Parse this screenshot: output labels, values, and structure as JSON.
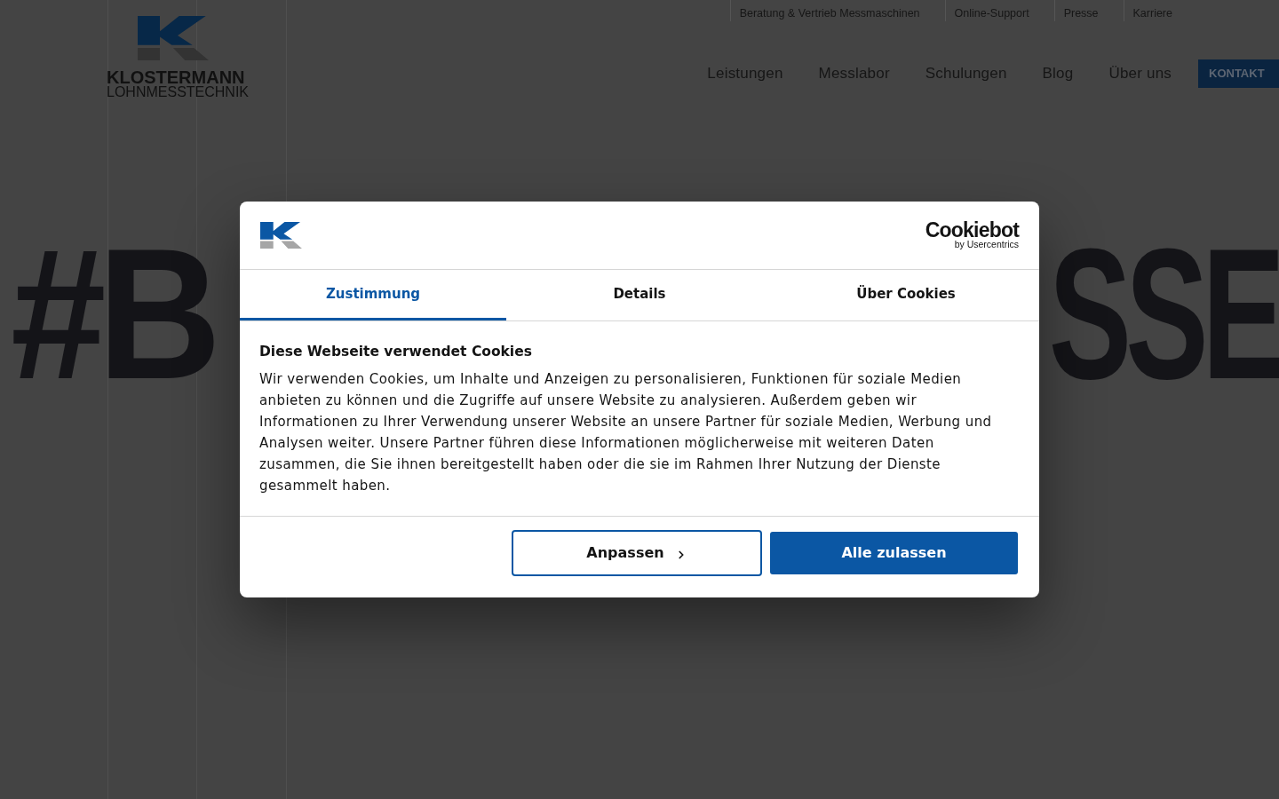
{
  "header": {
    "logo": {
      "name": "KLOSTERMANN",
      "tagline": "LOHNMESSTECHNIK"
    },
    "top_links": [
      "Beratung & Vertrieb Messmaschinen",
      "Online-Support",
      "Presse",
      "Karriere"
    ],
    "nav": [
      "Leistungen",
      "Messlabor",
      "Schulungen",
      "Blog",
      "Über uns"
    ],
    "contact_button": "KONTAKT"
  },
  "hero": {
    "headline_parts": [
      "#B",
      "SSE"
    ]
  },
  "cookie_dialog": {
    "provider": {
      "name": "Cookiebot",
      "byline": "by Usercentrics"
    },
    "tabs": [
      {
        "label": "Zustimmung",
        "selected": true
      },
      {
        "label": "Details",
        "selected": false
      },
      {
        "label": "Über Cookies",
        "selected": false
      }
    ],
    "title": "Diese Webseite verwendet Cookies",
    "body": "Wir verwenden Cookies, um Inhalte und Anzeigen zu personalisieren, Funktionen für soziale Medien anbieten zu können und die Zugriffe auf unsere Website zu analysieren. Außerdem geben wir Informationen zu Ihrer Verwendung unserer Website an unsere Partner für soziale Medien, Werbung und Analysen weiter. Unsere Partner führen diese Informationen möglicherweise mit weiteren Daten zusammen, die Sie ihnen bereitgestellt haben oder die sie im Rahmen Ihrer Nutzung der Dienste gesammelt haben.",
    "buttons": [
      {
        "label": "Anpassen",
        "kind": "secondary"
      },
      {
        "label": "Alle zulassen",
        "kind": "primary"
      }
    ]
  }
}
